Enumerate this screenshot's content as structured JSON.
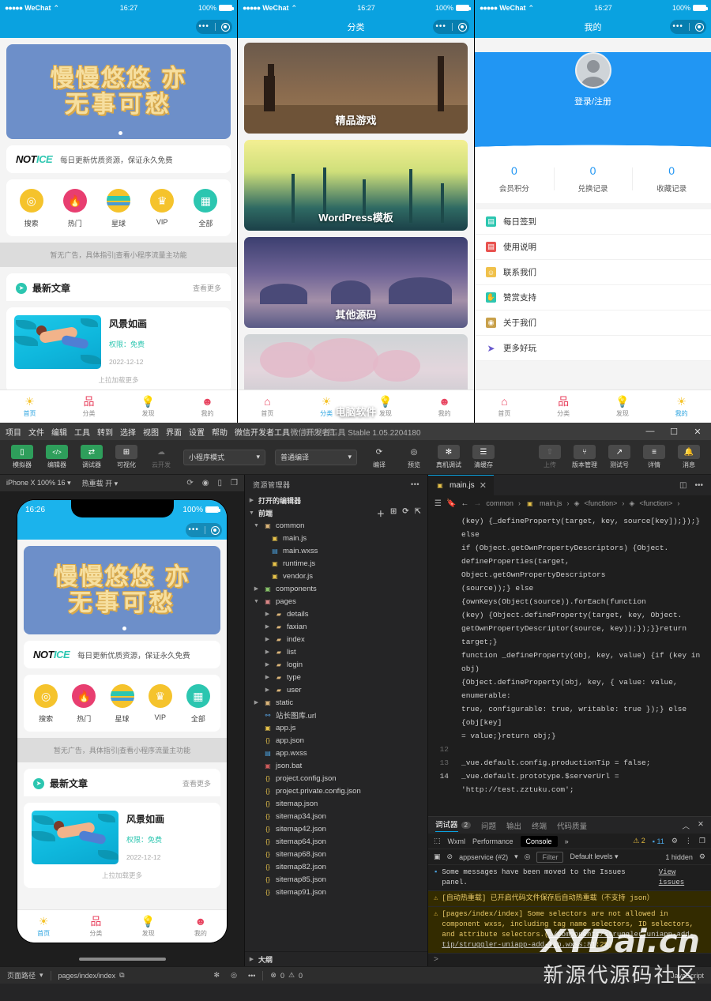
{
  "phones": {
    "status": {
      "carrier": "WeChat",
      "dots": "●●●●●",
      "time": "16:27",
      "battery": "100%"
    },
    "home": {
      "banner": {
        "line1": "慢慢悠悠 亦",
        "line2": "无事可愁"
      },
      "notice": {
        "logo1": "NOT",
        "logo2": "ICE",
        "text": "每日更新优质资源，保证永久免费"
      },
      "icons": [
        {
          "label": "搜索",
          "glyph": "🔍",
          "name": "search"
        },
        {
          "label": "热门",
          "glyph": "🔥",
          "name": "hot"
        },
        {
          "label": "星球",
          "glyph": "",
          "name": "planet"
        },
        {
          "label": "VIP",
          "glyph": "♛",
          "name": "vip"
        },
        {
          "label": "全部",
          "glyph": "▦",
          "name": "all"
        }
      ],
      "ad_text": "暂无广告，具体指引|查看小程序流量主功能",
      "section": {
        "title": "最新文章",
        "more": "查看更多"
      },
      "article": {
        "title": "风景如画",
        "permission": "权限：免费",
        "date": "2022-12-12"
      },
      "loadmore": "上拉加载更多"
    },
    "category": {
      "nav_title": "分类",
      "cards": [
        {
          "label": "精品游戏"
        },
        {
          "label": "WordPress模板"
        },
        {
          "label": "其他源码"
        },
        {
          "label": "电脑软件"
        }
      ]
    },
    "profile": {
      "nav_title": "我的",
      "login_text": "登录/注册",
      "stats": [
        {
          "value": "0",
          "label": "会员积分"
        },
        {
          "value": "0",
          "label": "兑换记录"
        },
        {
          "value": "0",
          "label": "收藏记录"
        }
      ],
      "menu": [
        {
          "label": "每日签到",
          "icon": "calendar-icon",
          "glyph": "▤",
          "color": "#2cc6b0"
        },
        {
          "label": "使用说明",
          "icon": "book-icon",
          "glyph": "▤",
          "color": "#e8524f"
        },
        {
          "label": "联系我们",
          "icon": "smile-icon",
          "glyph": "☺",
          "color": "#f0c14b"
        },
        {
          "label": "赞赏支持",
          "icon": "thumb-up-icon",
          "glyph": "👍",
          "color": "#2cc6b0"
        },
        {
          "label": "关于我们",
          "icon": "info-icon",
          "glyph": "◉",
          "color": "#c8a04a"
        },
        {
          "label": "更多好玩",
          "icon": "send-icon",
          "glyph": "➤",
          "color": "#6a5acd"
        }
      ]
    },
    "tabbar": [
      {
        "label": "首页",
        "glyph": "☀"
      },
      {
        "label": "分类",
        "glyph": "品"
      },
      {
        "label": "发现",
        "glyph": "💡"
      },
      {
        "label": "我的",
        "glyph": "👤"
      }
    ]
  },
  "ide": {
    "menu": [
      "项目",
      "文件",
      "编辑",
      "工具",
      "转到",
      "选择",
      "视图",
      "界面",
      "设置",
      "帮助",
      "微信开发者工具"
    ],
    "menu_project": "知识付费-",
    "app_title": "微信开发者工具 Stable 1.05.2204180",
    "window_buttons": {
      "minimize": "—",
      "maximize": "☐",
      "close": "✕"
    },
    "toolbar_left": [
      {
        "label": "模拟器",
        "glyph": "▯",
        "style": "green"
      },
      {
        "label": "编辑器",
        "glyph": "</>",
        "style": "green"
      },
      {
        "label": "调试器",
        "glyph": "⇄",
        "style": "green"
      },
      {
        "label": "可视化",
        "glyph": "⊞",
        "style": "gray"
      },
      {
        "label": "云开发",
        "glyph": "☁",
        "style": "dim"
      }
    ],
    "selects": [
      {
        "value": "小程序模式"
      },
      {
        "value": "普通编译"
      }
    ],
    "toolbar_mid": [
      {
        "label": "编译",
        "glyph": "⟳"
      },
      {
        "label": "预览",
        "glyph": "👁"
      },
      {
        "label": "真机调试",
        "glyph": "🐞"
      },
      {
        "label": "清缓存",
        "glyph": "☰"
      }
    ],
    "toolbar_right": [
      {
        "label": "上传",
        "glyph": "⇧",
        "dim": true
      },
      {
        "label": "版本管理",
        "glyph": "⎇"
      },
      {
        "label": "测试号",
        "glyph": "↗"
      },
      {
        "label": "详情",
        "glyph": "≡"
      },
      {
        "label": "消息",
        "glyph": "🔔"
      }
    ],
    "simulator": {
      "device": "iPhone X 100% 16",
      "hotreload": "热重载 开",
      "icons": [
        "refresh-icon",
        "record-icon",
        "rotate-icon",
        "window-icon"
      ],
      "phone_time": "16:26",
      "phone_battery": "100%"
    },
    "explorer": {
      "title": "资源管理器",
      "more": "•••",
      "open_editors": "打开的编辑器",
      "project_root": "前端",
      "tools": [
        "new-file-icon",
        "new-folder-icon",
        "refresh-icon",
        "collapse-icon"
      ],
      "tree": [
        {
          "depth": 1,
          "name": "common",
          "kind": "folder",
          "open": true
        },
        {
          "depth": 2,
          "name": "main.js",
          "kind": "js"
        },
        {
          "depth": 2,
          "name": "main.wxss",
          "kind": "css"
        },
        {
          "depth": 2,
          "name": "runtime.js",
          "kind": "js"
        },
        {
          "depth": 2,
          "name": "vendor.js",
          "kind": "js"
        },
        {
          "depth": 1,
          "name": "components",
          "kind": "folder-g",
          "open": false
        },
        {
          "depth": 1,
          "name": "pages",
          "kind": "folder-r",
          "open": true
        },
        {
          "depth": 2,
          "name": "details",
          "kind": "folder",
          "open": false
        },
        {
          "depth": 2,
          "name": "faxian",
          "kind": "folder",
          "open": false
        },
        {
          "depth": 2,
          "name": "index",
          "kind": "folder",
          "open": false
        },
        {
          "depth": 2,
          "name": "list",
          "kind": "folder",
          "open": false
        },
        {
          "depth": 2,
          "name": "login",
          "kind": "folder",
          "open": false
        },
        {
          "depth": 2,
          "name": "type",
          "kind": "folder",
          "open": false
        },
        {
          "depth": 2,
          "name": "user",
          "kind": "folder",
          "open": false
        },
        {
          "depth": 1,
          "name": "static",
          "kind": "folder",
          "open": false
        },
        {
          "depth": 1,
          "name": "站长图库.url",
          "kind": "url"
        },
        {
          "depth": 1,
          "name": "app.js",
          "kind": "js"
        },
        {
          "depth": 1,
          "name": "app.json",
          "kind": "json"
        },
        {
          "depth": 1,
          "name": "app.wxss",
          "kind": "css"
        },
        {
          "depth": 1,
          "name": "json.bat",
          "kind": "bat"
        },
        {
          "depth": 1,
          "name": "project.config.json",
          "kind": "json"
        },
        {
          "depth": 1,
          "name": "project.private.config.json",
          "kind": "json"
        },
        {
          "depth": 1,
          "name": "sitemap.json",
          "kind": "json"
        },
        {
          "depth": 1,
          "name": "sitemap34.json",
          "kind": "json"
        },
        {
          "depth": 1,
          "name": "sitemap42.json",
          "kind": "json"
        },
        {
          "depth": 1,
          "name": "sitemap64.json",
          "kind": "json"
        },
        {
          "depth": 1,
          "name": "sitemap68.json",
          "kind": "json"
        },
        {
          "depth": 1,
          "name": "sitemap82.json",
          "kind": "json"
        },
        {
          "depth": 1,
          "name": "sitemap85.json",
          "kind": "json"
        },
        {
          "depth": 1,
          "name": "sitemap91.json",
          "kind": "json"
        }
      ],
      "outline": "大纲"
    },
    "editor": {
      "tab": "main.js",
      "tab_close": "✕",
      "breadcrumb": [
        "common",
        "main.js",
        "<function>",
        "<function>"
      ],
      "lines": [
        {
          "num": "",
          "text": "(key) {_defineProperty(target, key, source[key]);});} else"
        },
        {
          "num": "",
          "text": "if (Object.getOwnPropertyDescriptors) {Object."
        },
        {
          "num": "",
          "text": "defineProperties(target, Object.getOwnPropertyDescriptors"
        },
        {
          "num": "",
          "text": "(source));} else {ownKeys(Object(source)).forEach(function"
        },
        {
          "num": "",
          "text": "(key) {Object.defineProperty(target, key, Object."
        },
        {
          "num": "",
          "text": "getOwnPropertyDescriptor(source, key));});}}return target;}"
        },
        {
          "num": "",
          "text": "function _defineProperty(obj, key, value) {if (key in obj)"
        },
        {
          "num": "",
          "text": "{Object.defineProperty(obj, key, { value: value, enumerable:"
        },
        {
          "num": "",
          "text": "true, configurable: true, writable: true });} else {obj[key]"
        },
        {
          "num": "",
          "text": "= value;}return obj;}"
        },
        {
          "num": "12",
          "text": ""
        },
        {
          "num": "13",
          "text": "_vue.default.config.productionTip = false;"
        },
        {
          "num": "14",
          "text": "_vue.default.prototype.$serverUrl = 'http://test.zztuku.com';"
        }
      ],
      "server_url": "http://test.zztuku.com"
    },
    "console": {
      "tabs": [
        {
          "label": "调试器",
          "badge": "2",
          "active": true
        },
        {
          "label": "问题",
          "badge": "",
          "active": false
        },
        {
          "label": "输出",
          "badge": "",
          "active": false
        },
        {
          "label": "终端",
          "badge": "",
          "active": false
        },
        {
          "label": "代码质量",
          "badge": "",
          "active": false
        }
      ],
      "collapse": "︿",
      "close": "✕",
      "subtabs": [
        "Wxml",
        "Performance",
        "Console",
        "»"
      ],
      "active_subtab": "Console",
      "counts": {
        "warnings": "2",
        "infos": "11"
      },
      "context": "appservice (#2)",
      "filter_placeholder": "Filter",
      "levels": "Default levels",
      "hidden": "1 hidden",
      "messages": [
        {
          "type": "info",
          "text": "Some messages have been moved to the Issues panel.",
          "link": "View issues"
        },
        {
          "type": "warn",
          "text": "[自动热重载] 已开启代码文件保存后自动热重载（不支持 json）"
        },
        {
          "type": "warn",
          "text": "[pages/index/index] Some selectors are not allowed in component wxss, including tag name selectors, ID selectors, and attribute selectors.(",
          "link": "./components/struggler-uniapp-add-tip/struggler-uniapp-add-tip.wxss:81",
          "tail": ":25)"
        }
      ],
      "prompt": ">"
    },
    "statusbar": {
      "page_path_label": "页面路径",
      "page_path": "pages/index/index",
      "copy_icon": "copy-icon",
      "errors": "0",
      "warnings": "0",
      "language": "JavaScript"
    }
  },
  "watermark": {
    "line1": "XYDai.cn",
    "line2": "新源代源码社区"
  }
}
